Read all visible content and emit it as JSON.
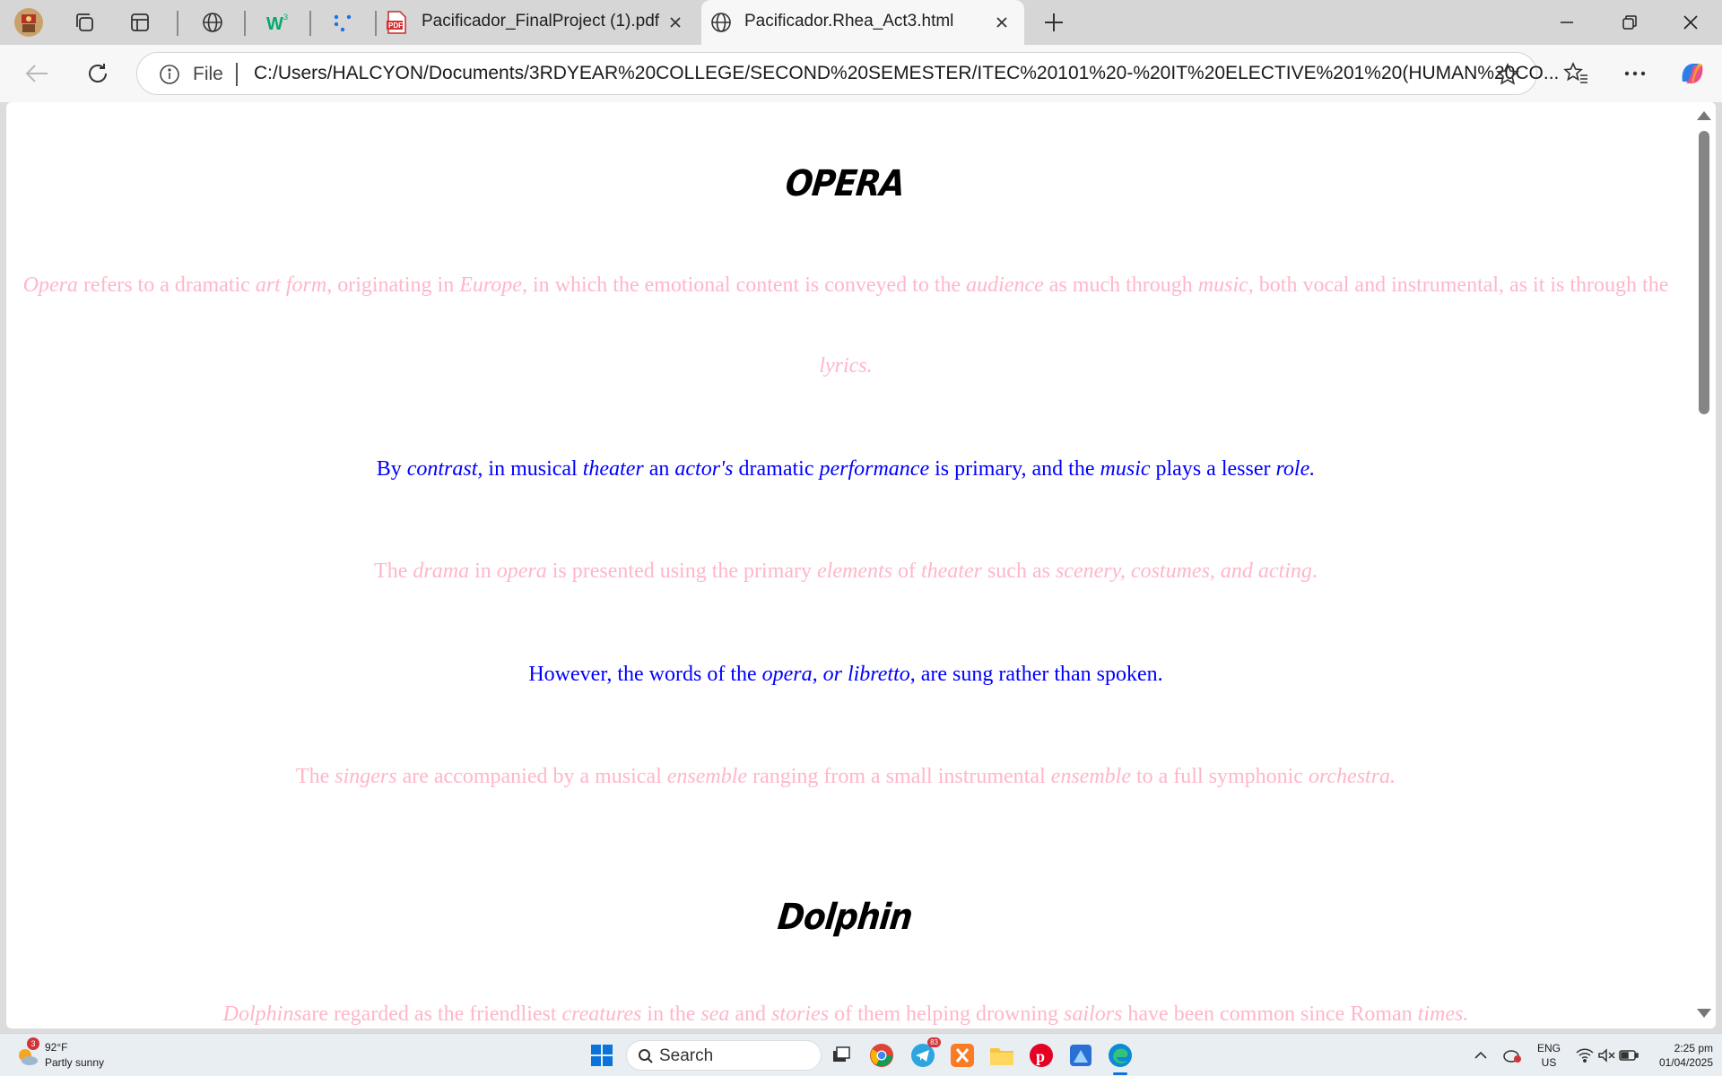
{
  "browser": {
    "tabs": [
      {
        "title": "Pacificador_FinalProject (1).pdf",
        "icon": "pdf-icon"
      },
      {
        "title": "Pacificador.Rhea_Act3.html",
        "icon": "globe-icon",
        "active": true
      }
    ],
    "address": {
      "scheme_label": "File",
      "url": "C:/Users/HALCYON/Documents/3RDYEAR%20COLLEGE/SECOND%20SEMESTER/ITEC%20101%20-%20IT%20ELECTIVE%201%20(HUMAN%20CO..."
    }
  },
  "page": {
    "sections": [
      {
        "heading": "OPERA",
        "paragraphs": [
          {
            "color": "pink",
            "runs": [
              {
                "t": "Opera",
                "i": true
              },
              {
                "t": " refers to a dramatic "
              },
              {
                "t": "art form",
                "i": true
              },
              {
                "t": ", originating in "
              },
              {
                "t": "Europe",
                "i": true
              },
              {
                "t": ", in which the emotional content is conveyed to the "
              },
              {
                "t": "audience",
                "i": true
              },
              {
                "t": " as much through "
              },
              {
                "t": "music",
                "i": true
              },
              {
                "t": ", both vocal and instrumental, as it is through the "
              },
              {
                "t": "lyrics.",
                "i": true
              }
            ]
          },
          {
            "color": "blue",
            "runs": [
              {
                "t": "By "
              },
              {
                "t": "contrast",
                "i": true
              },
              {
                "t": ", in musical "
              },
              {
                "t": "theater",
                "i": true
              },
              {
                "t": " an "
              },
              {
                "t": "actor's",
                "i": true
              },
              {
                "t": " dramatic "
              },
              {
                "t": "performance",
                "i": true
              },
              {
                "t": " is primary, and the "
              },
              {
                "t": "music",
                "i": true
              },
              {
                "t": " plays a lesser "
              },
              {
                "t": "role.",
                "i": true
              }
            ]
          },
          {
            "color": "pink",
            "runs": [
              {
                "t": "The "
              },
              {
                "t": "drama",
                "i": true
              },
              {
                "t": " in "
              },
              {
                "t": "opera",
                "i": true
              },
              {
                "t": " is presented using the primary "
              },
              {
                "t": "elements",
                "i": true
              },
              {
                "t": " of "
              },
              {
                "t": "theater",
                "i": true
              },
              {
                "t": " such as "
              },
              {
                "t": "scenery, costumes, and acting",
                "i": true
              },
              {
                "t": "."
              }
            ]
          },
          {
            "color": "blue",
            "runs": [
              {
                "t": "However, the words of the "
              },
              {
                "t": "opera, or libretto",
                "i": true
              },
              {
                "t": ", are sung rather than spoken."
              }
            ]
          },
          {
            "color": "pink",
            "runs": [
              {
                "t": "The "
              },
              {
                "t": "singers",
                "i": true
              },
              {
                "t": " are accompanied by a musical "
              },
              {
                "t": "ensemble",
                "i": true
              },
              {
                "t": " ranging from a small instrumental "
              },
              {
                "t": "ensemble",
                "i": true
              },
              {
                "t": " to a full symphonic "
              },
              {
                "t": "orchestra.",
                "i": true
              }
            ]
          }
        ]
      },
      {
        "heading": "Dolphin",
        "paragraphs": [
          {
            "color": "pink",
            "runs": [
              {
                "t": "Dolphins",
                "i": true
              },
              {
                "t": "are regarded as the friendliest "
              },
              {
                "t": "creatures",
                "i": true
              },
              {
                "t": " in the "
              },
              {
                "t": "sea",
                "i": true
              },
              {
                "t": " and "
              },
              {
                "t": "stories",
                "i": true
              },
              {
                "t": " of them helping drowning "
              },
              {
                "t": "sailors",
                "i": true
              },
              {
                "t": " have been common since Roman "
              },
              {
                "t": "times.",
                "i": true
              }
            ]
          }
        ]
      }
    ],
    "colors": {
      "pink": "#ffb6c8",
      "blue": "#0000ff"
    }
  },
  "taskbar": {
    "weather": {
      "temp": "92°F",
      "desc": "Partly sunny",
      "badge": "3"
    },
    "search_placeholder": "Search",
    "tray": {
      "lang_top": "ENG",
      "lang_bottom": "US",
      "time": "2:25 pm",
      "date": "01/04/2025"
    },
    "telegram_badge": "83"
  }
}
